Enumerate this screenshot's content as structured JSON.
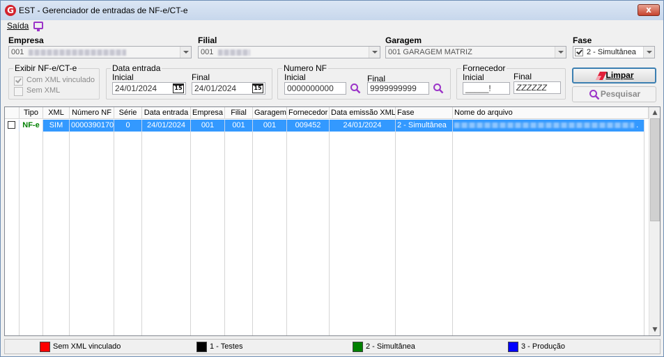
{
  "window": {
    "title": "EST - Gerenciador de entradas de NF-e/CT-e",
    "close_label": "x"
  },
  "menu": {
    "saida": "Saída"
  },
  "filters": {
    "empresa": {
      "label": "Empresa",
      "value": "001"
    },
    "filial": {
      "label": "Filial",
      "value": "001"
    },
    "garagem": {
      "label": "Garagem",
      "value": "001 GARAGEM MATRIZ"
    },
    "fase": {
      "label": "Fase",
      "value": "2 - Simultânea",
      "checked": true
    }
  },
  "exibir": {
    "legend": "Exibir NF-e/CT-e",
    "com_xml": {
      "label": "Com XML vinculado",
      "checked": true
    },
    "sem_xml": {
      "label": "Sem XML",
      "checked": false
    }
  },
  "data_entrada": {
    "legend": "Data entrada",
    "inicial_label": "Inicial",
    "inicial_value": "24/01/2024",
    "final_label": "Final",
    "final_value": "24/01/2024",
    "calendar_glyph": "15"
  },
  "numero_nf": {
    "legend": "Numero NF",
    "inicial_label": "Inicial",
    "inicial_value": "0000000000",
    "final_label": "Final",
    "final_value": "9999999999"
  },
  "fornecedor": {
    "legend": "Fornecedor",
    "inicial_label": "Inicial",
    "inicial_value": "_____!",
    "final_label": "Final",
    "final_value": "ZZZZZZ"
  },
  "buttons": {
    "limpar": "Limpar",
    "pesquisar": "Pesquisar"
  },
  "grid": {
    "columns": [
      "Tipo",
      "XML",
      "Número NF",
      "Série",
      "Data entrada",
      "Empresa",
      "Filial",
      "Garagem",
      "Fornecedor",
      "Data emissão XML",
      "Fase",
      "Nome do arquivo"
    ],
    "rows": [
      {
        "tipo": "NF-e",
        "xml": "SIM",
        "numero_nf": "0000390170",
        "serie": "0",
        "data_entrada": "24/01/2024",
        "empresa": "001",
        "filial": "001",
        "garagem": "001",
        "fornecedor": "009452",
        "data_emissao": "24/01/2024",
        "fase": "2 - Simultânea",
        "nome_arquivo_suffix": "."
      }
    ]
  },
  "legend_bar": [
    {
      "label": "Sem XML vinculado",
      "color": "#ff0000"
    },
    {
      "label": "1 - Testes",
      "color": "#000000"
    },
    {
      "label": "2 - Simultânea",
      "color": "#008000"
    },
    {
      "label": "3 - Produção",
      "color": "#0000ff"
    }
  ],
  "colors": {
    "selection": "#3399ff",
    "nfe_green": "#008000",
    "accent_icon": "#9b34c8"
  },
  "icons": [
    "app-logo-icon",
    "monitor-icon",
    "calendar-icon",
    "magnifier-icon",
    "eraser-icon"
  ]
}
